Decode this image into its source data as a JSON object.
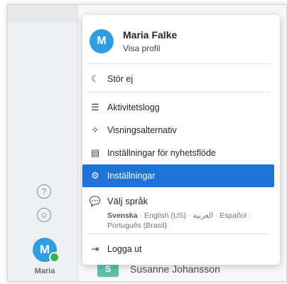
{
  "rail": {
    "help_icon": "question-circle",
    "smile_icon": "smiley-face",
    "avatar_initial": "M",
    "user_label": "Maria",
    "presence_color": "#37b24d"
  },
  "background": {
    "row_initial": "S",
    "row_name": "Susanne Johansson"
  },
  "menu": {
    "profile": {
      "avatar_initial": "M",
      "name": "Maria Falke",
      "link": "Visa profil"
    },
    "items": [
      {
        "label": "Stör ej",
        "icon": "moon"
      },
      {
        "label": "Aktivitetslogg",
        "icon": "list"
      },
      {
        "label": "Visningsalternativ",
        "icon": "sparkles"
      },
      {
        "label": "Inställningar för nyhetsflöde",
        "icon": "feed-window"
      },
      {
        "label": "Inställningar",
        "icon": "gear",
        "active": true
      },
      {
        "label": "Logga ut",
        "icon": "logout"
      }
    ],
    "language": {
      "title": "Välj språk",
      "icon": "speech-bubble",
      "options": [
        "Svenska",
        "English (US)",
        "العربية",
        "Español",
        "Português (Brasil)"
      ],
      "selected": "Svenska"
    },
    "accent_color": "#1d73d6"
  }
}
